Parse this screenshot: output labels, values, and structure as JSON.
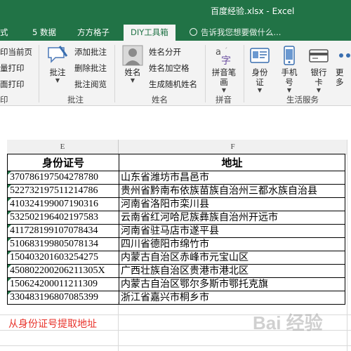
{
  "window": {
    "title": "百度经验.xlsx - Excel"
  },
  "tabs": [
    {
      "label": "式"
    },
    {
      "label": "5 数据"
    },
    {
      "label": "方方格子"
    },
    {
      "label": "DIY工具箱"
    }
  ],
  "tell_me": "告诉我您想要做什么...",
  "ribbon": {
    "print_group": {
      "items": [
        "印当前页",
        "量打印",
        "面打印"
      ],
      "label": "印"
    },
    "annotation_group": {
      "big_label": "批注",
      "items": [
        "添加批注",
        "删除批注",
        "批注阅览"
      ],
      "label": "批注"
    },
    "name_group": {
      "big_label": "姓名",
      "items": [
        "姓名分开",
        "姓名加空格",
        "生成随机姓名"
      ],
      "label": "姓名"
    },
    "pinyin_group": {
      "big_label_1": "拼音笔",
      "big_label_2": "画",
      "label": "拼音"
    },
    "life_group": {
      "buttons": [
        {
          "line1": "身份",
          "line2": "证"
        },
        {
          "line1": "手机",
          "line2": "号"
        },
        {
          "line1": "银行",
          "line2": "卡"
        },
        {
          "line1": "更多",
          "line2": ""
        }
      ],
      "label": "生活服务"
    }
  },
  "sheet": {
    "col_e": "E",
    "col_f": "F",
    "headers": {
      "id": "身份证号",
      "address": "地址"
    },
    "rows": [
      {
        "id": "370786197504278780",
        "address": "山东省潍坊市昌邑市"
      },
      {
        "id": "522732197511214786",
        "address": "贵州省黔南布依族苗族自治州三都水族自治县"
      },
      {
        "id": "410324199007190316",
        "address": "河南省洛阳市栾川县"
      },
      {
        "id": "532502196402197583",
        "address": "云南省红河哈尼族彝族自治州开远市"
      },
      {
        "id": "411728199107078434",
        "address": "河南省驻马店市遂平县"
      },
      {
        "id": "510683199805078134",
        "address": "四川省德阳市绵竹市"
      },
      {
        "id": "150403201603254275",
        "address": "内蒙古自治区赤峰市元宝山区"
      },
      {
        "id": "450802200206211305X",
        "address": "广西壮族自治区贵港市港北区"
      },
      {
        "id": "150624200011211309",
        "address": "内蒙古自治区鄂尔多斯市鄂托克旗"
      },
      {
        "id": "330483196807085399",
        "address": "浙江省嘉兴市桐乡市"
      }
    ]
  },
  "caption": "从身份证号提取地址",
  "watermark": "Bai 经验",
  "colors": {
    "excel_green": "#217346",
    "caption_red": "#e8322a"
  }
}
